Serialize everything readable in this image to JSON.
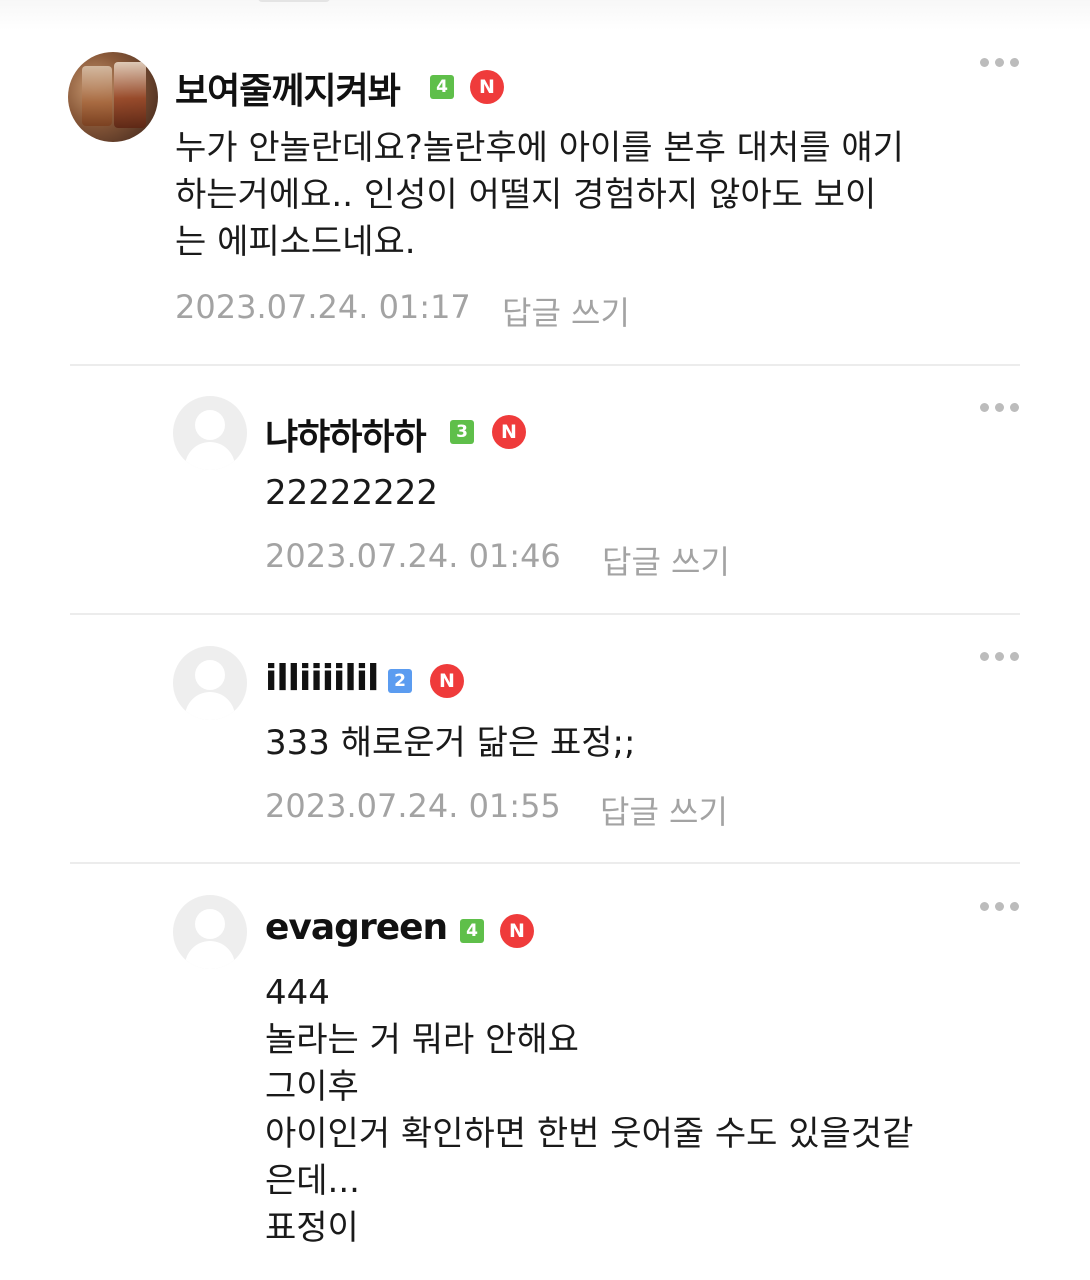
{
  "colors": {
    "level_green": "#5fbf4a",
    "level_blue": "#5b9cf0",
    "n_badge_red": "#ef3b3b",
    "meta_gray": "#a3a3a3"
  },
  "comments": [
    {
      "nickname": "보여줄께지켜봐",
      "level": "4",
      "badge": "N",
      "text": "누가 안놀란데요?놀란후에 아이를 본후 대처를 얘기\n하는거에요..  인성이 어떨지 경험하지 않아도 보이\n는 에피소드네요.",
      "date": "2023.07.24. 01:17",
      "reply_label": "답글 쓰기",
      "more_icon": "more-icon"
    },
    {
      "nickname": "냐햐하하하",
      "level": "3",
      "badge": "N",
      "text": "22222222",
      "date": "2023.07.24. 01:46",
      "reply_label": "답글 쓰기",
      "more_icon": "more-icon"
    },
    {
      "nickname": "illiiiilil",
      "level": "2",
      "badge": "N",
      "text": "333 해로운거 닮은 표정;;",
      "date": "2023.07.24. 01:55",
      "reply_label": "답글 쓰기",
      "more_icon": "more-icon"
    },
    {
      "nickname": "evagreen",
      "level": "4",
      "badge": "N",
      "text": "444\n놀라는 거 뭐라 안해요\n그이후\n아이인거 확인하면 한번 웃어줄 수도 있을것같\n은데...\n표정이",
      "more_icon": "more-icon"
    }
  ]
}
